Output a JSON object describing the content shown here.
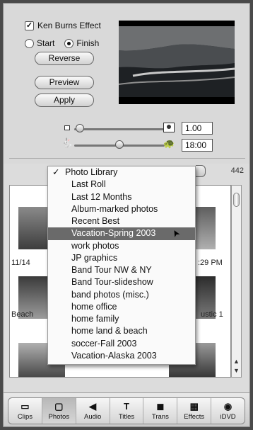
{
  "effects": {
    "ken_burns_label": "Ken Burns Effect",
    "ken_burns_checked": true,
    "start_label": "Start",
    "finish_label": "Finish",
    "selected_mode": "Finish",
    "reverse_label": "Reverse",
    "preview_label": "Preview",
    "apply_label": "Apply",
    "zoom_value": "1.00",
    "duration_value": "18:00"
  },
  "browser": {
    "photo_count": "442",
    "menu_items": [
      "Photo Library",
      "Last Roll",
      "Last 12 Months",
      "Album-marked photos",
      "Recent Best",
      "Vacation-Spring 2003",
      "work photos",
      "JP graphics",
      "Band Tour NW & NY",
      "Band Tour-slideshow",
      "band photos (misc.)",
      "home office",
      "home family",
      "home land & beach",
      "soccer-Fall 2003",
      "Vacation-Alaska 2003"
    ],
    "checked_item": "Photo Library",
    "selected_item": "Vacation-Spring 2003",
    "captions": {
      "c1": "11/14",
      "c2": ":29 PM",
      "c3": "Beach",
      "c4": "ustic 1"
    }
  },
  "toolbar": {
    "buttons": [
      {
        "label": "Clips",
        "icon": "clips-icon"
      },
      {
        "label": "Photos",
        "icon": "photos-icon"
      },
      {
        "label": "Audio",
        "icon": "audio-icon"
      },
      {
        "label": "Titles",
        "icon": "titles-icon"
      },
      {
        "label": "Trans",
        "icon": "trans-icon"
      },
      {
        "label": "Effects",
        "icon": "effects-icon"
      },
      {
        "label": "iDVD",
        "icon": "idvd-icon"
      }
    ],
    "active": "Photos"
  }
}
